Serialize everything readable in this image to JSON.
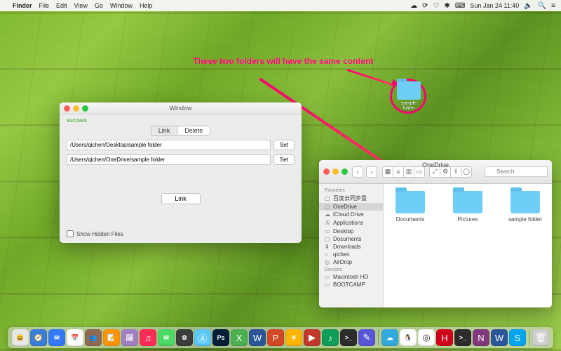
{
  "menubar": {
    "app": "Finder",
    "items": [
      "File",
      "Edit",
      "View",
      "Go",
      "Window",
      "Help"
    ],
    "clock": "Sun Jan 24  11:40"
  },
  "annotation": {
    "text": "These two folders will have the same content"
  },
  "desktop_folder": {
    "label": "sample folder"
  },
  "link_window": {
    "title": "Window",
    "status": "success",
    "tabs": {
      "link": "Link",
      "delete": "Delete"
    },
    "path1": "/Users/qichen/Desktop/sample folder",
    "path2": "/Users/qichen/OneDrive/sample folder",
    "set_label": "Set",
    "link_button": "Link",
    "show_hidden": "Show Hidden Files"
  },
  "finder": {
    "title": "OneDrive",
    "search_placeholder": "Search",
    "sidebar": {
      "favorites_h": "Favorites",
      "devices_h": "Devices",
      "favorites": [
        "百度云同步盘",
        "OneDrive",
        "iCloud Drive",
        "Applications",
        "Desktop",
        "Documents",
        "Downloads",
        "qichen",
        "AirDrop"
      ],
      "devices": [
        "Macintosh HD",
        "BOOTCAMP"
      ]
    },
    "items": [
      {
        "label": "Documents"
      },
      {
        "label": "Pictures"
      },
      {
        "label": "sample folder"
      }
    ]
  },
  "dock_icons": [
    {
      "bg": "#e8e8e8",
      "g": "😀",
      "name": "finder"
    },
    {
      "bg": "#3c7dd9",
      "g": "🧭",
      "name": "safari"
    },
    {
      "bg": "#3478f6",
      "g": "✉︎",
      "name": "mail"
    },
    {
      "bg": "#ffffff",
      "g": "📅",
      "name": "calendar"
    },
    {
      "bg": "#8f6a53",
      "g": "👥",
      "name": "contacts"
    },
    {
      "bg": "#ff9500",
      "g": "📝",
      "name": "notes"
    },
    {
      "bg": "#a080c0",
      "g": "🖼",
      "name": "photos"
    },
    {
      "bg": "#ff2d55",
      "g": "♫",
      "name": "itunes"
    },
    {
      "bg": "#4cd964",
      "g": "✉︎",
      "name": "messages"
    },
    {
      "bg": "#3c3c3c",
      "g": "⚙︎",
      "name": "settings"
    },
    {
      "bg": "#5ac8fa",
      "g": "Ⓐ",
      "name": "appstore"
    },
    {
      "bg": "#001e36",
      "g": "Ps",
      "name": "photoshop"
    },
    {
      "bg": "#4caf50",
      "g": "X",
      "name": "excel"
    },
    {
      "bg": "#2b579a",
      "g": "W",
      "name": "word"
    },
    {
      "bg": "#d24726",
      "g": "P",
      "name": "powerpoint"
    },
    {
      "bg": "#ffb400",
      "g": "☀︎",
      "name": "weather"
    },
    {
      "bg": "#c0392b",
      "g": "▶",
      "name": "media"
    },
    {
      "bg": "#0f9d58",
      "g": "♪",
      "name": "spotify"
    },
    {
      "bg": "#2c2c2c",
      "g": ">_",
      "name": "terminal"
    },
    {
      "bg": "#5856d6",
      "g": "✎",
      "name": "textedit"
    },
    {
      "bg": "#34aadc",
      "g": "☁︎",
      "name": "cloud"
    },
    {
      "bg": "#ffffff",
      "g": "🐧",
      "name": "qq"
    },
    {
      "bg": "#ffffff",
      "g": "◎",
      "name": "app"
    },
    {
      "bg": "#d0021b",
      "g": "H",
      "name": "app-h"
    },
    {
      "bg": "#2c2c2c",
      "g": ">_",
      "name": "iterm"
    },
    {
      "bg": "#80397b",
      "g": "N",
      "name": "onenote"
    },
    {
      "bg": "#2b579a",
      "g": "W",
      "name": "word2"
    },
    {
      "bg": "#00a4ef",
      "g": "S",
      "name": "skype"
    }
  ]
}
